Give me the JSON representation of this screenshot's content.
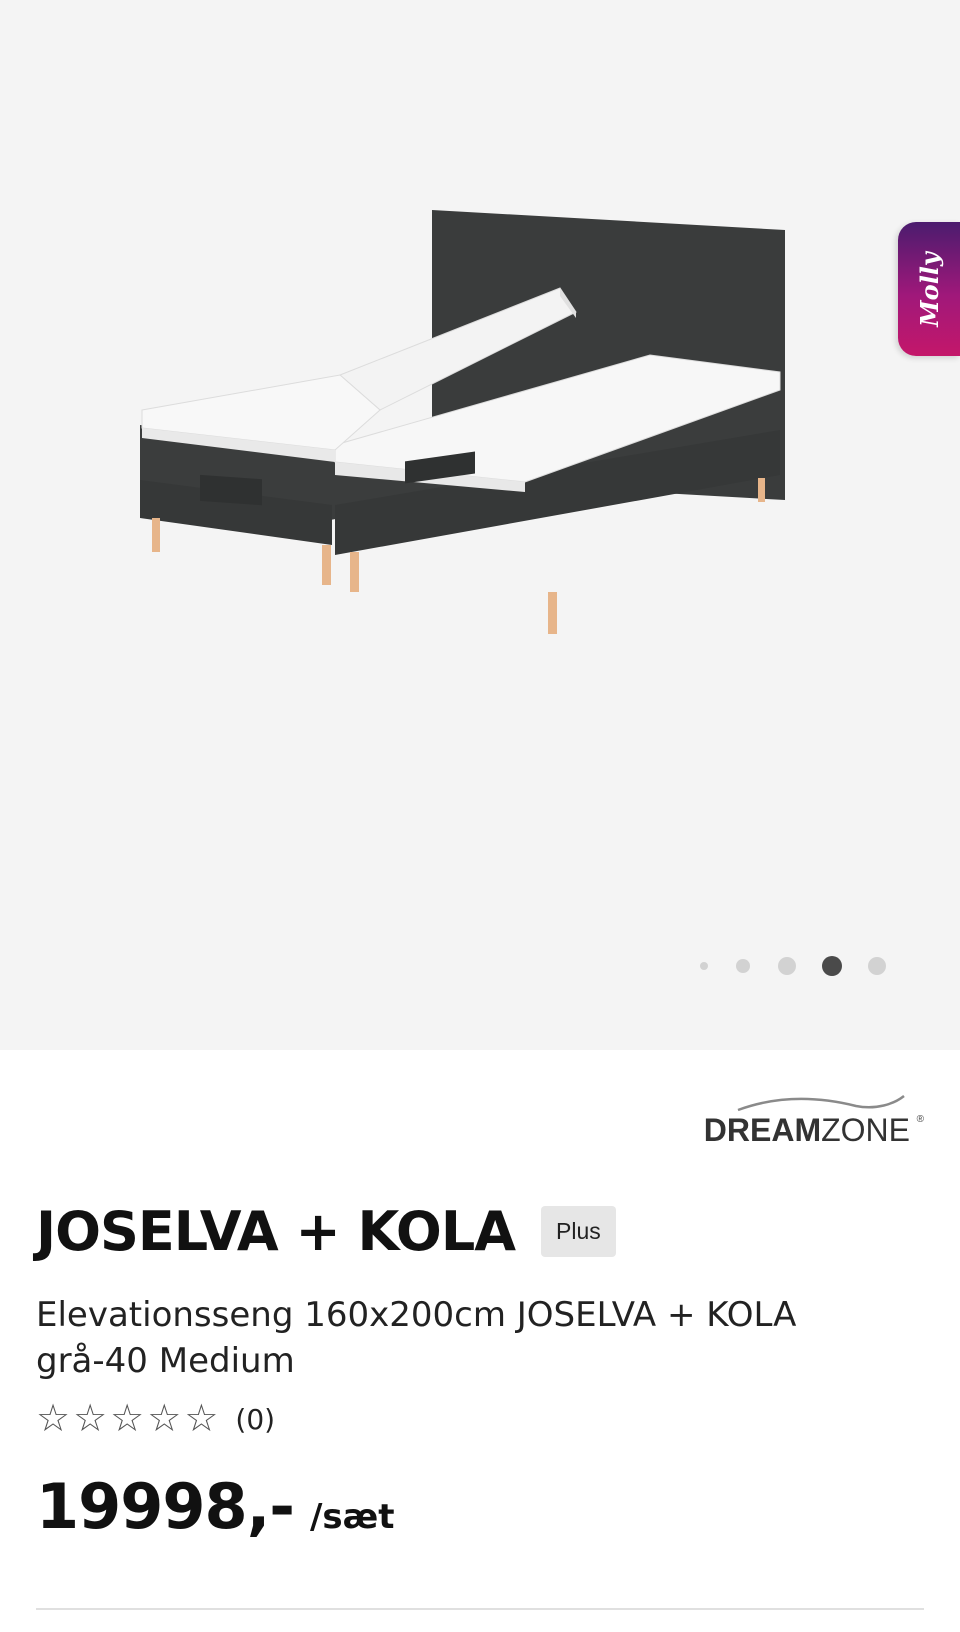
{
  "gallery": {
    "image_alt": "Elevationsseng JOSELVA + KOLA",
    "slide_count": 5,
    "active_slide": 4,
    "dot_colors": {
      "inactive": "#d2d2d2",
      "active": "#4a4a4a"
    }
  },
  "chat_widget": {
    "label": "Molly"
  },
  "brand": {
    "name_bold": "DREAM",
    "name_regular": "ZONE",
    "registered": "®"
  },
  "product": {
    "title": "JOSELVA + KOLA",
    "badge": "Plus",
    "subtitle": "Elevationsseng 160x200cm JOSELVA + KOLA grå-40 Medium",
    "rating": {
      "stars": 0,
      "max_stars": 5,
      "review_count": "(0)"
    },
    "price": "19998,-",
    "price_unit": "/sæt"
  },
  "colors": {
    "accent_gradient_start": "#4b1c6e",
    "accent_gradient_end": "#c4176a"
  }
}
